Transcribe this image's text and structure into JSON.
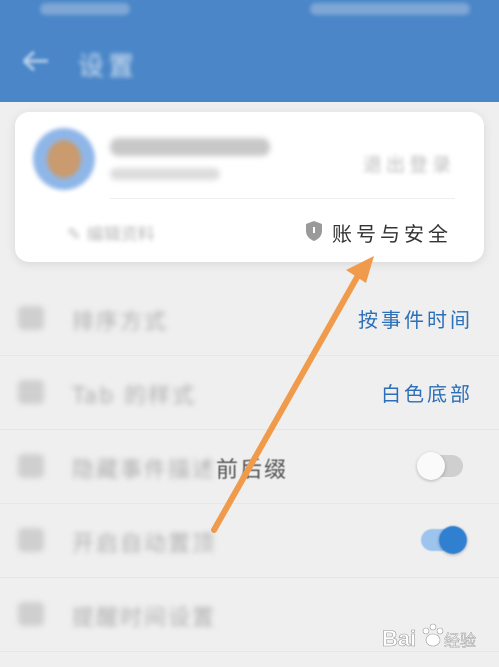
{
  "header": {
    "title": "设置"
  },
  "account_card": {
    "logout_label": "退出登录",
    "edit_profile_label": "编辑资料",
    "security_label": "账号与安全"
  },
  "settings": [
    {
      "label": "排序方式",
      "value": "按事件时间"
    },
    {
      "label": "Tab 的样式",
      "value": "白色底部"
    },
    {
      "label_blur": "隐藏事件描述",
      "label_clear": "前后缀",
      "toggle": "off"
    },
    {
      "label": "开启自动置顶",
      "toggle": "on"
    },
    {
      "label": "提醒时间设置"
    }
  ],
  "annotation": {
    "arrow_color": "#f09a4b"
  },
  "watermark": {
    "brand": "Bai",
    "brand_suffix": "经验"
  },
  "colors": {
    "accent": "#4a86c8",
    "value_text": "#2c6fb8"
  }
}
